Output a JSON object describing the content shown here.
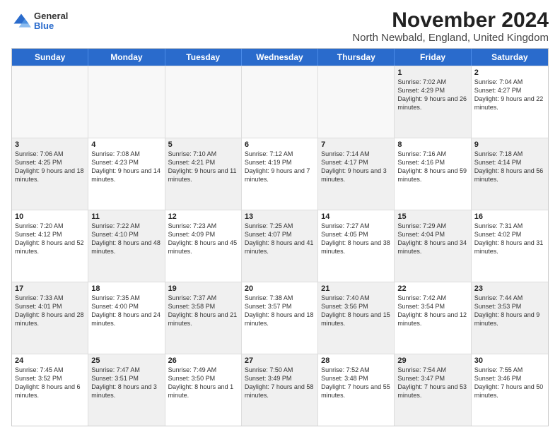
{
  "logo": {
    "general": "General",
    "blue": "Blue"
  },
  "title": "November 2024",
  "subtitle": "North Newbald, England, United Kingdom",
  "headers": [
    "Sunday",
    "Monday",
    "Tuesday",
    "Wednesday",
    "Thursday",
    "Friday",
    "Saturday"
  ],
  "rows": [
    [
      {
        "day": "",
        "text": "",
        "empty": true
      },
      {
        "day": "",
        "text": "",
        "empty": true
      },
      {
        "day": "",
        "text": "",
        "empty": true
      },
      {
        "day": "",
        "text": "",
        "empty": true
      },
      {
        "day": "",
        "text": "",
        "empty": true
      },
      {
        "day": "1",
        "text": "Sunrise: 7:02 AM\nSunset: 4:29 PM\nDaylight: 9 hours and 26 minutes.",
        "shaded": true
      },
      {
        "day": "2",
        "text": "Sunrise: 7:04 AM\nSunset: 4:27 PM\nDaylight: 9 hours and 22 minutes.",
        "shaded": false
      }
    ],
    [
      {
        "day": "3",
        "text": "Sunrise: 7:06 AM\nSunset: 4:25 PM\nDaylight: 9 hours and 18 minutes.",
        "shaded": true
      },
      {
        "day": "4",
        "text": "Sunrise: 7:08 AM\nSunset: 4:23 PM\nDaylight: 9 hours and 14 minutes.",
        "shaded": false
      },
      {
        "day": "5",
        "text": "Sunrise: 7:10 AM\nSunset: 4:21 PM\nDaylight: 9 hours and 11 minutes.",
        "shaded": true
      },
      {
        "day": "6",
        "text": "Sunrise: 7:12 AM\nSunset: 4:19 PM\nDaylight: 9 hours and 7 minutes.",
        "shaded": false
      },
      {
        "day": "7",
        "text": "Sunrise: 7:14 AM\nSunset: 4:17 PM\nDaylight: 9 hours and 3 minutes.",
        "shaded": true
      },
      {
        "day": "8",
        "text": "Sunrise: 7:16 AM\nSunset: 4:16 PM\nDaylight: 8 hours and 59 minutes.",
        "shaded": false
      },
      {
        "day": "9",
        "text": "Sunrise: 7:18 AM\nSunset: 4:14 PM\nDaylight: 8 hours and 56 minutes.",
        "shaded": true
      }
    ],
    [
      {
        "day": "10",
        "text": "Sunrise: 7:20 AM\nSunset: 4:12 PM\nDaylight: 8 hours and 52 minutes.",
        "shaded": false
      },
      {
        "day": "11",
        "text": "Sunrise: 7:22 AM\nSunset: 4:10 PM\nDaylight: 8 hours and 48 minutes.",
        "shaded": true
      },
      {
        "day": "12",
        "text": "Sunrise: 7:23 AM\nSunset: 4:09 PM\nDaylight: 8 hours and 45 minutes.",
        "shaded": false
      },
      {
        "day": "13",
        "text": "Sunrise: 7:25 AM\nSunset: 4:07 PM\nDaylight: 8 hours and 41 minutes.",
        "shaded": true
      },
      {
        "day": "14",
        "text": "Sunrise: 7:27 AM\nSunset: 4:05 PM\nDaylight: 8 hours and 38 minutes.",
        "shaded": false
      },
      {
        "day": "15",
        "text": "Sunrise: 7:29 AM\nSunset: 4:04 PM\nDaylight: 8 hours and 34 minutes.",
        "shaded": true
      },
      {
        "day": "16",
        "text": "Sunrise: 7:31 AM\nSunset: 4:02 PM\nDaylight: 8 hours and 31 minutes.",
        "shaded": false
      }
    ],
    [
      {
        "day": "17",
        "text": "Sunrise: 7:33 AM\nSunset: 4:01 PM\nDaylight: 8 hours and 28 minutes.",
        "shaded": true
      },
      {
        "day": "18",
        "text": "Sunrise: 7:35 AM\nSunset: 4:00 PM\nDaylight: 8 hours and 24 minutes.",
        "shaded": false
      },
      {
        "day": "19",
        "text": "Sunrise: 7:37 AM\nSunset: 3:58 PM\nDaylight: 8 hours and 21 minutes.",
        "shaded": true
      },
      {
        "day": "20",
        "text": "Sunrise: 7:38 AM\nSunset: 3:57 PM\nDaylight: 8 hours and 18 minutes.",
        "shaded": false
      },
      {
        "day": "21",
        "text": "Sunrise: 7:40 AM\nSunset: 3:56 PM\nDaylight: 8 hours and 15 minutes.",
        "shaded": true
      },
      {
        "day": "22",
        "text": "Sunrise: 7:42 AM\nSunset: 3:54 PM\nDaylight: 8 hours and 12 minutes.",
        "shaded": false
      },
      {
        "day": "23",
        "text": "Sunrise: 7:44 AM\nSunset: 3:53 PM\nDaylight: 8 hours and 9 minutes.",
        "shaded": true
      }
    ],
    [
      {
        "day": "24",
        "text": "Sunrise: 7:45 AM\nSunset: 3:52 PM\nDaylight: 8 hours and 6 minutes.",
        "shaded": false
      },
      {
        "day": "25",
        "text": "Sunrise: 7:47 AM\nSunset: 3:51 PM\nDaylight: 8 hours and 3 minutes.",
        "shaded": true
      },
      {
        "day": "26",
        "text": "Sunrise: 7:49 AM\nSunset: 3:50 PM\nDaylight: 8 hours and 1 minute.",
        "shaded": false
      },
      {
        "day": "27",
        "text": "Sunrise: 7:50 AM\nSunset: 3:49 PM\nDaylight: 7 hours and 58 minutes.",
        "shaded": true
      },
      {
        "day": "28",
        "text": "Sunrise: 7:52 AM\nSunset: 3:48 PM\nDaylight: 7 hours and 55 minutes.",
        "shaded": false
      },
      {
        "day": "29",
        "text": "Sunrise: 7:54 AM\nSunset: 3:47 PM\nDaylight: 7 hours and 53 minutes.",
        "shaded": true
      },
      {
        "day": "30",
        "text": "Sunrise: 7:55 AM\nSunset: 3:46 PM\nDaylight: 7 hours and 50 minutes.",
        "shaded": false
      }
    ]
  ]
}
